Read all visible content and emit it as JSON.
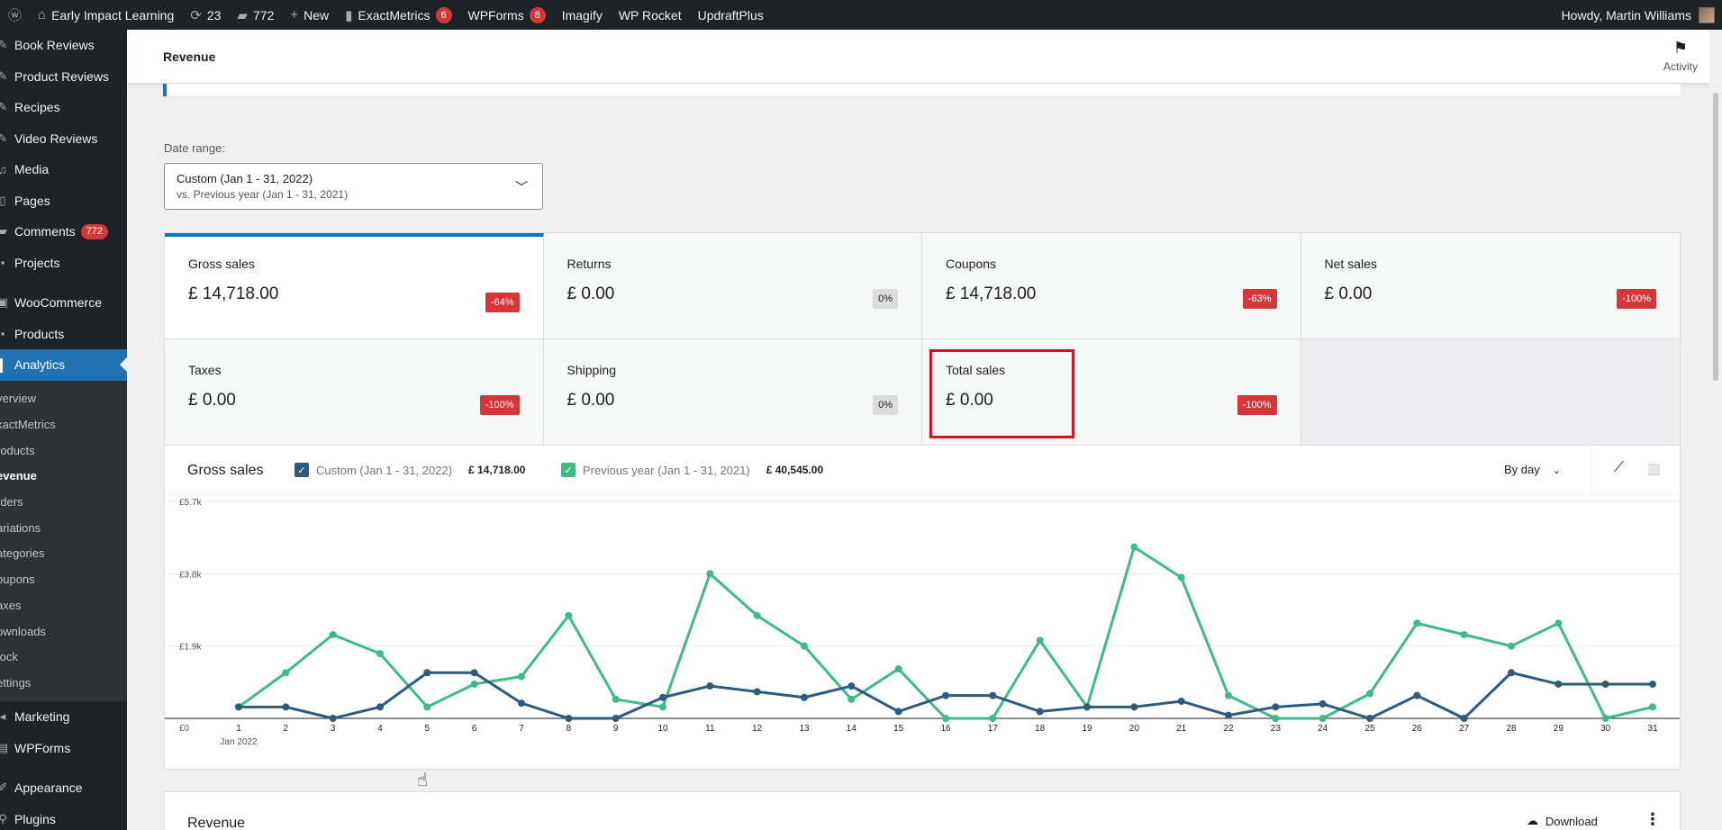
{
  "adminbar": {
    "site_name": "Early Impact Learning",
    "updates_count": "23",
    "comments_count": "772",
    "new_label": "New",
    "exactmetrics_label": "ExactMetrics",
    "exactmetrics_badge": "6",
    "wpforms_label": "WPForms",
    "wpforms_badge": "8",
    "imagify_label": "Imagify",
    "wprocket_label": "WP Rocket",
    "updraft_label": "UpdraftPlus",
    "greeting": "Howdy, Martin Williams"
  },
  "sidebar": {
    "items": [
      {
        "label": "Book Reviews",
        "icon": "pin-icon"
      },
      {
        "label": "Product Reviews",
        "icon": "pin-icon"
      },
      {
        "label": "Recipes",
        "icon": "pin-icon"
      },
      {
        "label": "Video Reviews",
        "icon": "pin-icon"
      },
      {
        "label": "Media",
        "icon": "media-icon"
      },
      {
        "label": "Pages",
        "icon": "page-icon"
      },
      {
        "label": "Comments",
        "icon": "comment-icon",
        "badge": "772"
      },
      {
        "label": "Projects",
        "icon": "portfolio-icon"
      },
      {
        "label": "WooCommerce",
        "icon": "woo-icon"
      },
      {
        "label": "Products",
        "icon": "archive-icon"
      },
      {
        "label": "Analytics",
        "icon": "chart-icon"
      }
    ],
    "submenu": [
      "verview",
      "xactMetrics",
      "roducts",
      "evenue",
      "rders",
      "ariations",
      "ategories",
      "oupons",
      "axes",
      "ownloads",
      "tock",
      "ettings"
    ],
    "items_after": [
      {
        "label": "Marketing",
        "icon": "megaphone-icon"
      },
      {
        "label": "WPForms",
        "icon": "forms-icon"
      },
      {
        "label": "Appearance",
        "icon": "brush-icon"
      },
      {
        "label": "Plugins",
        "icon": "plugin-icon"
      }
    ]
  },
  "header": {
    "title": "Revenue",
    "activity_label": "Activity"
  },
  "date_range": {
    "label": "Date range:",
    "primary": "Custom (Jan 1 - 31, 2022)",
    "secondary": "vs. Previous year (Jan 1 - 31, 2021)"
  },
  "tiles": [
    {
      "label": "Gross sales",
      "value": "£ 14,718.00",
      "delta": "-64%",
      "negative": true,
      "selected": true
    },
    {
      "label": "Returns",
      "value": "£ 0.00",
      "delta": "0%",
      "negative": false
    },
    {
      "label": "Coupons",
      "value": "£ 14,718.00",
      "delta": "-63%",
      "negative": true
    },
    {
      "label": "Net sales",
      "value": "£ 0.00",
      "delta": "-100%",
      "negative": true
    },
    {
      "label": "Taxes",
      "value": "£ 0.00",
      "delta": "-100%",
      "negative": true
    },
    {
      "label": "Shipping",
      "value": "£ 0.00",
      "delta": "0%",
      "negative": false
    },
    {
      "label": "Total sales",
      "value": "£ 0.00",
      "delta": "-100%",
      "negative": true
    }
  ],
  "chart_panel": {
    "title": "Gross sales",
    "interval": "By day",
    "legend": [
      {
        "label": "Custom (Jan 1 - 31, 2022)",
        "amount": "£ 14,718.00",
        "color": "#2e5b7c"
      },
      {
        "label": "Previous year (Jan 1 - 31, 2021)",
        "amount": "£ 40,545.00",
        "color": "#3dbb85"
      }
    ]
  },
  "chart_data": {
    "type": "line",
    "x": [
      1,
      2,
      3,
      4,
      5,
      6,
      7,
      8,
      9,
      10,
      11,
      12,
      13,
      14,
      15,
      16,
      17,
      18,
      19,
      20,
      21,
      22,
      23,
      24,
      25,
      26,
      27,
      28,
      29,
      30,
      31
    ],
    "x_tick_sub": "Jan 2022",
    "y_ticks": [
      "£0",
      "£1.9k",
      "£3.8k",
      "£5.7k"
    ],
    "ylim": [
      0,
      5700
    ],
    "series": [
      {
        "name": "Custom (Jan 1 - 31, 2022)",
        "color": "#2e5b7c",
        "values": [
          300,
          300,
          0,
          300,
          1200,
          1200,
          400,
          0,
          0,
          550,
          850,
          700,
          550,
          850,
          180,
          600,
          600,
          180,
          300,
          300,
          450,
          80,
          300,
          380,
          0,
          600,
          0,
          1200,
          900,
          900,
          900
        ]
      },
      {
        "name": "Previous year (Jan 1 - 31, 2021)",
        "color": "#3dbb85",
        "values": [
          300,
          1200,
          2200,
          1700,
          300,
          900,
          1100,
          2700,
          500,
          300,
          3800,
          2700,
          1900,
          500,
          1300,
          0,
          0,
          2050,
          300,
          4500,
          3700,
          600,
          0,
          0,
          650,
          2500,
          2200,
          1900,
          2500,
          0,
          300
        ]
      }
    ]
  },
  "revenue_panel": {
    "title": "Revenue",
    "download_label": "Download"
  }
}
